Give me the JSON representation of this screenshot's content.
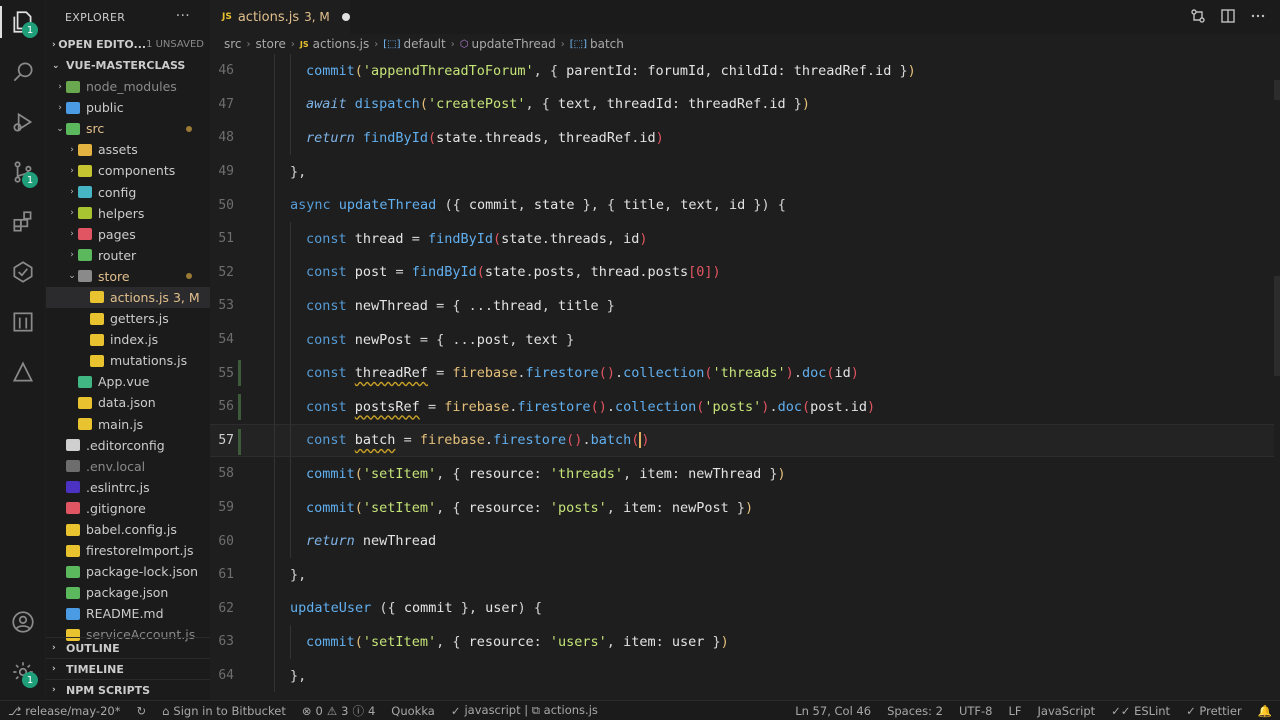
{
  "explorer": {
    "title": "EXPLORER",
    "more": "···",
    "open_editors": "OPEN EDITO...",
    "unsaved": "1 UNSAVED",
    "project": "VUE-MASTERCLASS",
    "tree": [
      {
        "label": "node_modules",
        "depth": 1,
        "chev": "›",
        "icon": "#6aa84f",
        "muted": true
      },
      {
        "label": "public",
        "depth": 1,
        "chev": "›",
        "icon": "#4a9be3"
      },
      {
        "label": "src",
        "depth": 1,
        "chev": "⌄",
        "icon": "#5cb85c",
        "color": "#e2c08d",
        "dot": true
      },
      {
        "label": "assets",
        "depth": 2,
        "chev": "›",
        "icon": "#e3b341"
      },
      {
        "label": "components",
        "depth": 2,
        "chev": "›",
        "icon": "#c5c531"
      },
      {
        "label": "config",
        "depth": 2,
        "chev": "›",
        "icon": "#46b6c5"
      },
      {
        "label": "helpers",
        "depth": 2,
        "chev": "›",
        "icon": "#a8c531"
      },
      {
        "label": "pages",
        "depth": 2,
        "chev": "›",
        "icon": "#e05561"
      },
      {
        "label": "router",
        "depth": 2,
        "chev": "›",
        "icon": "#5cb85c"
      },
      {
        "label": "store",
        "depth": 2,
        "chev": "⌄",
        "icon": "#8a8a8a",
        "color": "#e2c08d",
        "dot": true
      },
      {
        "label": "actions.js",
        "depth": 3,
        "icon": "#e8c22f",
        "color": "#e2c08d",
        "badge": "3, M",
        "selected": true
      },
      {
        "label": "getters.js",
        "depth": 3,
        "icon": "#e8c22f"
      },
      {
        "label": "index.js",
        "depth": 3,
        "icon": "#e8c22f"
      },
      {
        "label": "mutations.js",
        "depth": 3,
        "icon": "#e8c22f"
      },
      {
        "label": "App.vue",
        "depth": 2,
        "icon": "#41b883"
      },
      {
        "label": "data.json",
        "depth": 2,
        "icon": "#e8c22f"
      },
      {
        "label": "main.js",
        "depth": 2,
        "icon": "#e8c22f"
      },
      {
        "label": ".editorconfig",
        "depth": 1,
        "icon": "#cfcfcf"
      },
      {
        "label": ".env.local",
        "depth": 1,
        "icon": "#6d6d6d",
        "muted": true
      },
      {
        "label": ".eslintrc.js",
        "depth": 1,
        "icon": "#4b32c3"
      },
      {
        "label": ".gitignore",
        "depth": 1,
        "icon": "#e05561"
      },
      {
        "label": "babel.config.js",
        "depth": 1,
        "icon": "#e8c22f"
      },
      {
        "label": "firestoreImport.js",
        "depth": 1,
        "icon": "#e8c22f"
      },
      {
        "label": "package-lock.json",
        "depth": 1,
        "icon": "#5cb85c"
      },
      {
        "label": "package.json",
        "depth": 1,
        "icon": "#5cb85c"
      },
      {
        "label": "README.md",
        "depth": 1,
        "icon": "#4a9be3"
      },
      {
        "label": "serviceAccount.js",
        "depth": 1,
        "icon": "#e8c22f",
        "muted": true
      }
    ],
    "outline": "OUTLINE",
    "timeline": "TIMELINE",
    "npm_scripts": "NPM SCRIPTS"
  },
  "tab": {
    "name": "actions.js",
    "status": "3, M",
    "lang_badge": "JS"
  },
  "breadcrumb": [
    "src",
    "store",
    "actions.js",
    "default",
    "updateThread",
    "batch"
  ],
  "editor": {
    "current_line": 57,
    "lines": [
      {
        "n": 46,
        "indent": 2,
        "html": "<span class='f'>commit</span><span class='o'>(</span><span class='s'>'appendThreadToForum'</span><span class='p'>, { </span><span class='w'>parentId</span><span class='p'>: </span><span class='w'>forumId</span><span class='p'>, </span><span class='w'>childId</span><span class='p'>: </span><span class='w'>threadRef</span><span class='p'>.</span><span class='w'>id</span><span class='p'> }</span><span class='o'>)</span>"
      },
      {
        "n": 47,
        "indent": 2,
        "html": "<span class='k2'>await</span> <span class='f'>dispatch</span><span class='o'>(</span><span class='s'>'createPost'</span><span class='p'>, { </span><span class='w'>text</span><span class='p'>, </span><span class='w'>threadId</span><span class='p'>: </span><span class='w'>threadRef</span><span class='p'>.</span><span class='w'>id</span><span class='p'> }</span><span class='o'>)</span>"
      },
      {
        "n": 48,
        "indent": 2,
        "html": "<span class='k2'>return</span> <span class='f'>findById</span><span class='pr'>(</span><span class='w'>state</span><span class='p'>.</span><span class='w'>threads</span><span class='p'>, </span><span class='w'>threadRef</span><span class='p'>.</span><span class='w'>id</span><span class='pr'>)</span>"
      },
      {
        "n": 49,
        "indent": 1,
        "html": "<span class='p'>},</span>"
      },
      {
        "n": 50,
        "indent": 1,
        "html": "<span class='k'>async</span> <span class='f'>updateThread</span> <span class='p'>({ </span><span class='w'>commit</span><span class='p'>, </span><span class='w'>state</span><span class='p'> }, { </span><span class='w'>title</span><span class='p'>, </span><span class='w'>text</span><span class='p'>, </span><span class='w'>id</span><span class='p'> }) {</span>"
      },
      {
        "n": 51,
        "indent": 2,
        "html": "<span class='k'>const</span> <span class='w'>thread</span> <span class='p'>=</span> <span class='f'>findById</span><span class='pr'>(</span><span class='w'>state</span><span class='p'>.</span><span class='w'>threads</span><span class='p'>, </span><span class='w'>id</span><span class='pr'>)</span>"
      },
      {
        "n": 52,
        "indent": 2,
        "html": "<span class='k'>const</span> <span class='w'>post</span> <span class='p'>=</span> <span class='f'>findById</span><span class='pr'>(</span><span class='w'>state</span><span class='p'>.</span><span class='w'>posts</span><span class='p'>, </span><span class='w'>thread</span><span class='p'>.</span><span class='w'>posts</span><span class='pr'>[</span><span class='pr'>0</span><span class='pr'>])</span>"
      },
      {
        "n": 53,
        "indent": 2,
        "html": "<span class='k'>const</span> <span class='w'>newThread</span> <span class='p'>= { ...</span><span class='w'>thread</span><span class='p'>, </span><span class='w'>title</span><span class='p'> }</span>"
      },
      {
        "n": 54,
        "indent": 2,
        "html": "<span class='k'>const</span> <span class='w'>newPost</span> <span class='p'>= { ...</span><span class='w'>post</span><span class='p'>, </span><span class='w'>text</span><span class='p'> }</span>"
      },
      {
        "n": 55,
        "indent": 2,
        "mark": true,
        "html": "<span class='k'>const</span> <span class='w squig'>threadRef</span> <span class='p'>=</span> <span class='o'>firebase</span><span class='p'>.</span><span class='f'>firestore</span><span class='pr'>()</span><span class='p'>.</span><span class='f'>collection</span><span class='pr'>(</span><span class='s'>'threads'</span><span class='pr'>)</span><span class='p'>.</span><span class='f'>doc</span><span class='pr'>(</span><span class='w'>id</span><span class='pr'>)</span>"
      },
      {
        "n": 56,
        "indent": 2,
        "mark": true,
        "html": "<span class='k'>const</span> <span class='w squig'>postsRef</span> <span class='p'>=</span> <span class='o'>firebase</span><span class='p'>.</span><span class='f'>firestore</span><span class='pr'>()</span><span class='p'>.</span><span class='f'>collection</span><span class='pr'>(</span><span class='s'>'posts'</span><span class='pr'>)</span><span class='p'>.</span><span class='f'>doc</span><span class='pr'>(</span><span class='w'>post</span><span class='p'>.</span><span class='w'>id</span><span class='pr'>)</span>"
      },
      {
        "n": 57,
        "indent": 2,
        "mark": true,
        "html": "<span class='k'>const</span> <span class='w squig'>batch</span> <span class='p'>=</span> <span class='o'>firebase</span><span class='p'>.</span><span class='f'>firestore</span><span class='pr'>()</span><span class='p'>.</span><span class='f'>batch</span><span class='pr'>(</span><span class='cursor'></span><span class='pr'>)</span>"
      },
      {
        "n": 58,
        "indent": 2,
        "html": "<span class='f'>commit</span><span class='o'>(</span><span class='s'>'setItem'</span><span class='p'>, { </span><span class='w'>resource</span><span class='p'>: </span><span class='s'>'threads'</span><span class='p'>, </span><span class='w'>item</span><span class='p'>: </span><span class='w'>newThread</span><span class='p'> }</span><span class='o'>)</span>"
      },
      {
        "n": 59,
        "indent": 2,
        "html": "<span class='f'>commit</span><span class='o'>(</span><span class='s'>'setItem'</span><span class='p'>, { </span><span class='w'>resource</span><span class='p'>: </span><span class='s'>'posts'</span><span class='p'>, </span><span class='w'>item</span><span class='p'>: </span><span class='w'>newPost</span><span class='p'> }</span><span class='o'>)</span>"
      },
      {
        "n": 60,
        "indent": 2,
        "html": "<span class='k2'>return</span> <span class='w'>newThread</span>"
      },
      {
        "n": 61,
        "indent": 1,
        "html": "<span class='p'>},</span>"
      },
      {
        "n": 62,
        "indent": 1,
        "html": "<span class='f'>updateUser</span> <span class='p'>({ </span><span class='w'>commit</span><span class='p'> }, </span><span class='w'>user</span><span class='p'>) {</span>"
      },
      {
        "n": 63,
        "indent": 2,
        "html": "<span class='f'>commit</span><span class='o'>(</span><span class='s'>'setItem'</span><span class='p'>, { </span><span class='w'>resource</span><span class='p'>: </span><span class='s'>'users'</span><span class='p'>, </span><span class='w'>item</span><span class='p'>: </span><span class='w'>user</span><span class='p'> }</span><span class='o'>)</span>"
      },
      {
        "n": 64,
        "indent": 1,
        "html": "<span class='p'>},</span>"
      }
    ]
  },
  "status": {
    "branch": "release/may-20*",
    "sync": "↻",
    "bitbucket": "Sign in to Bitbucket",
    "errors": "0",
    "warnings": "3",
    "infos": "4",
    "quokka": "Quokka",
    "lang_path": "javascript | ⧉ actions.js",
    "position": "Ln 57, Col 46",
    "spaces": "Spaces: 2",
    "encoding": "UTF-8",
    "eol": "LF",
    "language": "JavaScript",
    "eslint": "✓✓ ESLint",
    "prettier": "✓ Prettier"
  }
}
